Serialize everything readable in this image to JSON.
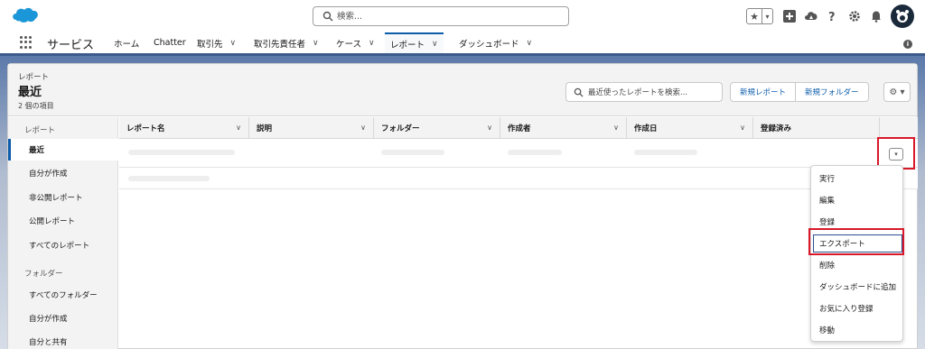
{
  "header": {
    "search_placeholder": "検索...",
    "fav_star": "★",
    "fav_caret": "▾"
  },
  "nav": {
    "app_name": "サービス",
    "tabs": [
      {
        "label": "ホーム",
        "has_menu": false
      },
      {
        "label": "Chatter",
        "has_menu": false
      },
      {
        "label": "取引先",
        "has_menu": true
      },
      {
        "label": "取引先責任者",
        "has_menu": true
      },
      {
        "label": "ケース",
        "has_menu": true
      },
      {
        "label": "レポート",
        "has_menu": true,
        "active": true
      },
      {
        "label": "ダッシュボード",
        "has_menu": true
      }
    ],
    "chevron": "∨"
  },
  "page_header": {
    "eyebrow": "レポート",
    "title": "最近",
    "count": "2 個の項目",
    "search_placeholder": "最近使ったレポートを検索...",
    "new_report": "新規レポート",
    "new_folder": "新規フォルダー",
    "gear": "⚙ ▾"
  },
  "sidebar": {
    "reports_section": "レポート",
    "report_items": [
      "最近",
      "自分が作成",
      "非公開レポート",
      "公開レポート",
      "すべてのレポート"
    ],
    "folders_section": "フォルダー",
    "folder_items": [
      "すべてのフォルダー",
      "自分が作成",
      "自分と共有"
    ]
  },
  "table": {
    "columns": [
      "レポート名",
      "説明",
      "フォルダー",
      "作成者",
      "作成日",
      "登録済み"
    ],
    "chevron": "∨"
  },
  "row_action": {
    "caret": "▾"
  },
  "menu": {
    "items": [
      "実行",
      "編集",
      "登録",
      "エクスポート",
      "削除",
      "ダッシュボードに追加",
      "お気に入り登録",
      "移動"
    ]
  },
  "colors": {
    "brand": "#0b5cab",
    "highlight": "#d9182a",
    "band": "#3f5f95"
  }
}
